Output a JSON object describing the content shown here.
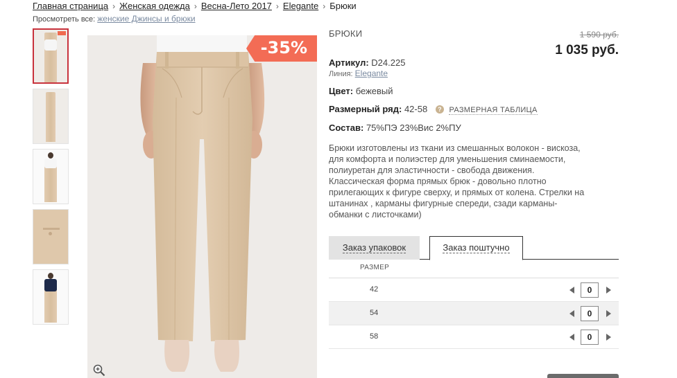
{
  "breadcrumb": {
    "items": [
      "Главная страница",
      "Женская одежда",
      "Весна-Лето 2017",
      "Elegante"
    ],
    "separator": "›",
    "current": "Брюки"
  },
  "view_all": {
    "label": "Просмотреть все:",
    "link": "женские Джинсы и брюки"
  },
  "sale_badge": "-35%",
  "product": {
    "type": "БРЮКИ",
    "old_price": "1 590 руб.",
    "new_price": "1 035 руб.",
    "article_label": "Артикул:",
    "article_value": "D24.225",
    "line_label": "Линия:",
    "line_value": "Elegante",
    "color_label": "Цвет:",
    "color_value": "бежевый",
    "size_range_label": "Размерный ряд:",
    "size_range_value": "42-58",
    "size_table_link": "РАЗМЕРНАЯ ТАБЛИЦА",
    "help_icon": "?",
    "composition_label": "Состав:",
    "composition_value": "75%ПЭ 23%Вис 2%ПУ",
    "description": [
      "Брюки изготовлены из ткани из смешанных волокон - вискоза,",
      "для комфорта и полиэстер для уменьшения сминаемости,",
      "полиуретан для эластичности - свобода движения.",
      "Классическая форма прямых брюк - довольно плотно",
      "прилегающих к фигуре сверху, и прямых от колена. Стрелки на",
      "штанинах , карманы фигурные спереди, сзади карманы-",
      "обманки с листочками)"
    ]
  },
  "tabs": {
    "pack": "Заказ упаковок",
    "piece": "Заказ поштучно"
  },
  "size_table": {
    "header": "РАЗМЕР",
    "rows": [
      {
        "size": "42",
        "qty": "0"
      },
      {
        "size": "54",
        "qty": "0"
      },
      {
        "size": "58",
        "qty": "0"
      }
    ]
  },
  "colors": {
    "sale": "#f36c55",
    "thumb_active_border": "#c8323c",
    "fabric": "#dcc4a6"
  },
  "icons": {
    "zoom": "magnifier-plus-icon",
    "help": "question-circle-icon",
    "decrease": "triangle-left-icon",
    "increase": "triangle-right-icon"
  }
}
